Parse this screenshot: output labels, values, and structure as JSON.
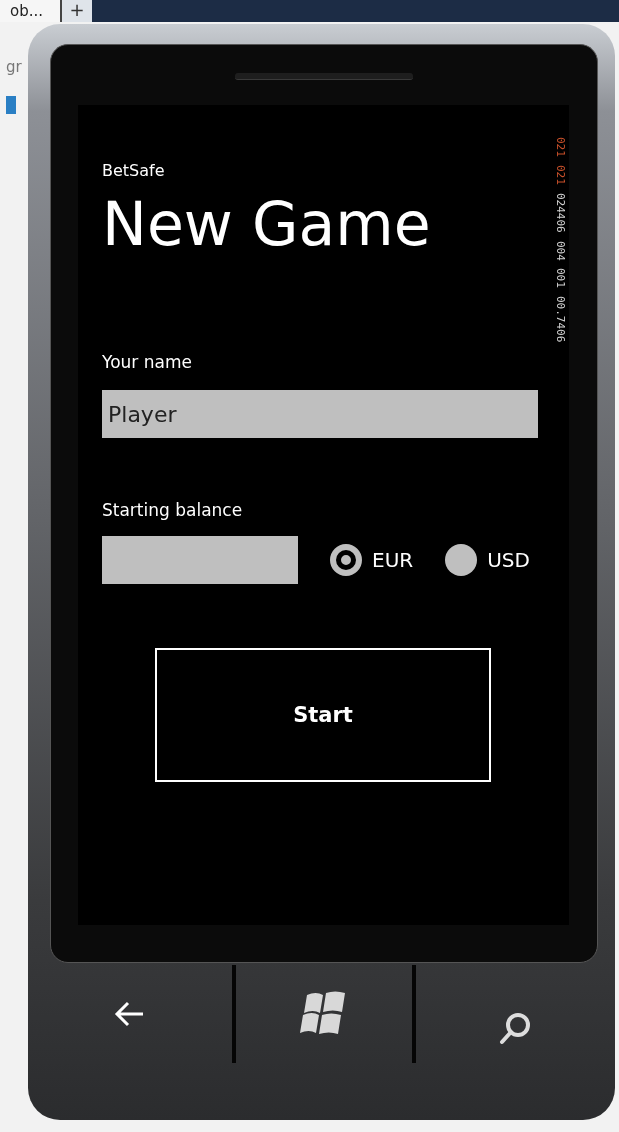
{
  "browser": {
    "tab": "ob...",
    "new_tab": "+",
    "address_fragment": "gr"
  },
  "app": {
    "name": "BetSafe",
    "page_title": "New Game"
  },
  "form": {
    "name_label": "Your name",
    "name_value": "Player",
    "balance_label": "Starting balance",
    "currencies": [
      {
        "label": "EUR",
        "selected": true
      },
      {
        "label": "USD",
        "selected": false
      }
    ],
    "start_button": "Start"
  },
  "frame_counters": [
    {
      "value": "021",
      "kind": "warning"
    },
    {
      "value": "021",
      "kind": "warning"
    },
    {
      "value": "024406",
      "kind": "normal"
    },
    {
      "value": "004",
      "kind": "normal"
    },
    {
      "value": "001",
      "kind": "normal"
    },
    {
      "value": "00.7406",
      "kind": "normal"
    }
  ]
}
